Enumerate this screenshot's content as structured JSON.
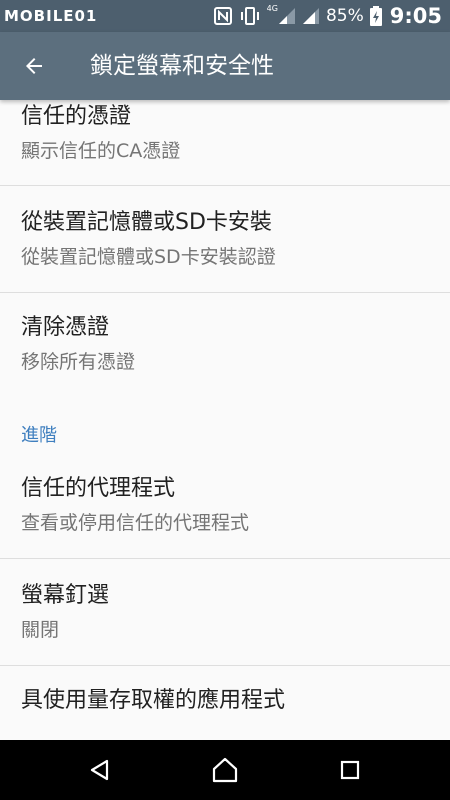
{
  "status_bar": {
    "watermark": "MOBILE01",
    "network": "4G",
    "battery_percent": "85%",
    "time": "9:05",
    "icons": [
      "nfc-icon",
      "vibrate-icon",
      "signal-icon",
      "signal-icon",
      "battery-charging-icon"
    ]
  },
  "toolbar": {
    "title": "鎖定螢幕和安全性",
    "back_icon": "arrow-back-icon"
  },
  "settings": {
    "trusted_credentials": {
      "title": "信任的憑證",
      "summary": "顯示信任的CA憑證"
    },
    "install_from_storage": {
      "title": "從裝置記憶體或SD卡安裝",
      "summary": "從裝置記憶體或SD卡安裝認證"
    },
    "clear_credentials": {
      "title": "清除憑證",
      "summary": "移除所有憑證"
    },
    "advanced_header": "進階",
    "trust_agents": {
      "title": "信任的代理程式",
      "summary": "查看或停用信任的代理程式"
    },
    "screen_pinning": {
      "title": "螢幕釘選",
      "summary": "關閉"
    },
    "usage_access": {
      "title": "具使用量存取權的應用程式"
    }
  },
  "nav_bar": {
    "icons": [
      "back-triangle-icon",
      "home-icon",
      "recents-icon"
    ]
  },
  "colors": {
    "status_bar": "#4d5f6e",
    "toolbar": "#5c6f7e",
    "accent": "#3f7fbf",
    "background": "#fafafa"
  }
}
